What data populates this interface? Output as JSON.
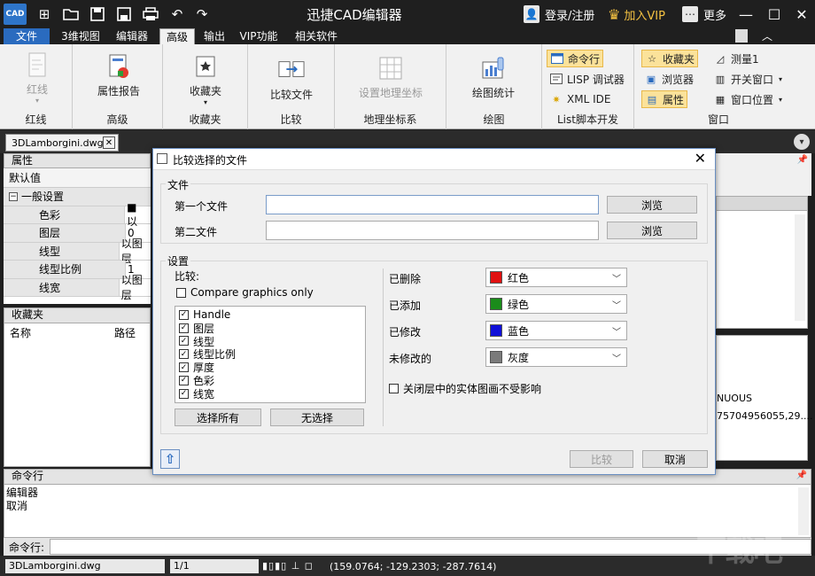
{
  "app": {
    "logo_text": "CAD",
    "title": "迅捷CAD编辑器",
    "login": "登录/注册",
    "vip": "加入VIP",
    "more": "更多"
  },
  "menu": {
    "items": [
      "文件",
      "3维视图",
      "编辑器",
      "高级",
      "输出",
      "VIP功能",
      "相关软件"
    ]
  },
  "ribbon": {
    "g1": {
      "btn": "红线",
      "label": "红线"
    },
    "g2": {
      "btn": "属性报告",
      "label": "高级"
    },
    "g3": {
      "btn": "收藏夹",
      "label": "收藏夹"
    },
    "g4": {
      "btn": "比较文件",
      "label": "比较"
    },
    "g5": {
      "btn": "设置地理坐标",
      "label": "地理坐标系"
    },
    "g6": {
      "btn": "绘图统计",
      "label": "绘图"
    },
    "g7": {
      "items": [
        "命令行",
        "LISP 调试器",
        "XML IDE"
      ],
      "label": "List脚本开发"
    },
    "g8": {
      "items": [
        "收藏夹",
        "浏览器",
        "属性",
        "测量1",
        "开关窗口",
        "窗口位置"
      ],
      "label": "窗口"
    }
  },
  "document": {
    "tab": "3DLamborgini.dwg"
  },
  "properties": {
    "header": "属性",
    "default": "默认值",
    "section": "一般设置",
    "rows": [
      {
        "key": "色彩",
        "value": "■ 以"
      },
      {
        "key": "图层",
        "value": "0"
      },
      {
        "key": "线型",
        "value": "以图层"
      },
      {
        "key": "线型比例",
        "value": "1"
      },
      {
        "key": "线宽",
        "value": "以图层"
      }
    ]
  },
  "favorites": {
    "header": "收藏夹",
    "col_name": "名称",
    "col_path": "路径"
  },
  "right_panel": {
    "line1": "NUOUS",
    "line2": "75704956055,29...."
  },
  "command": {
    "header": "命令行",
    "lines": [
      "编辑器",
      "取消"
    ],
    "prompt": "命令行:"
  },
  "status": {
    "file": "3DLamborgini.dwg",
    "page": "1/1",
    "coords": "(159.0764; -129.2303; -287.7614)"
  },
  "dialog": {
    "title": "比较选择的文件",
    "files_legend": "文件",
    "first_file_label": "第一个文件",
    "second_file_label": "第二文件",
    "browse": "浏览",
    "settings_legend": "设置",
    "compare_label": "比较:",
    "compare_graphics_only": "Compare graphics only",
    "compare_items": [
      "Handle",
      "图层",
      "线型",
      "线型比例",
      "厚度",
      "色彩",
      "线宽"
    ],
    "select_all": "选择所有",
    "select_none": "无选择",
    "deleted_label": "已删除",
    "added_label": "已添加",
    "modified_label": "已修改",
    "unmodified_label": "未修改的",
    "deleted_color": "红色",
    "added_color": "绿色",
    "modified_color": "蓝色",
    "unmodified_color": "灰度",
    "closed_layer_option": "关闭层中的实体图画不受影响",
    "compare_button": "比较",
    "cancel_button": "取消"
  },
  "colors": {
    "deleted": "#e01010",
    "added": "#1a8c1a",
    "modified": "#1010d8",
    "unmodified": "#7a7a7a",
    "accent": "#2a6bbf",
    "vip": "#f5c242"
  }
}
